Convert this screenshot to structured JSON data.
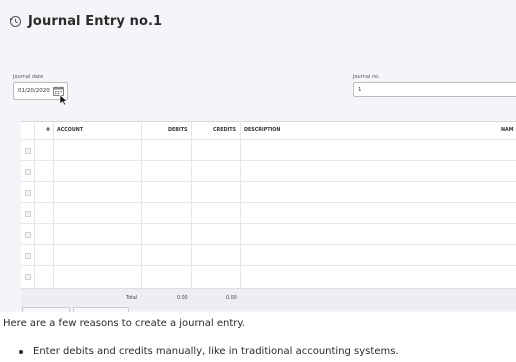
{
  "header": {
    "title": "Journal Entry no.1"
  },
  "form": {
    "journal_date_label": "Journal date",
    "journal_date_value": "01/20/2020",
    "journal_no_label": "Journal no.",
    "journal_no_value": "1"
  },
  "table": {
    "columns": {
      "num": "#",
      "account": "ACCOUNT",
      "debits": "DEBITS",
      "credits": "CREDITS",
      "description": "DESCRIPTION",
      "name": "NAM"
    },
    "rows_visible": 7,
    "total_label": "Total",
    "total_debits": "0.00",
    "total_credits": "0.00"
  },
  "article": {
    "intro": "Here are a few reasons to create a journal entry.",
    "bullets": [
      "Enter debits and credits manually, like in traditional accounting systems."
    ]
  },
  "icons": {
    "history": "history-icon",
    "calendar": "calendar-icon",
    "cursor": "mouse-pointer-icon",
    "row_handle": "drag-handle-icon"
  }
}
